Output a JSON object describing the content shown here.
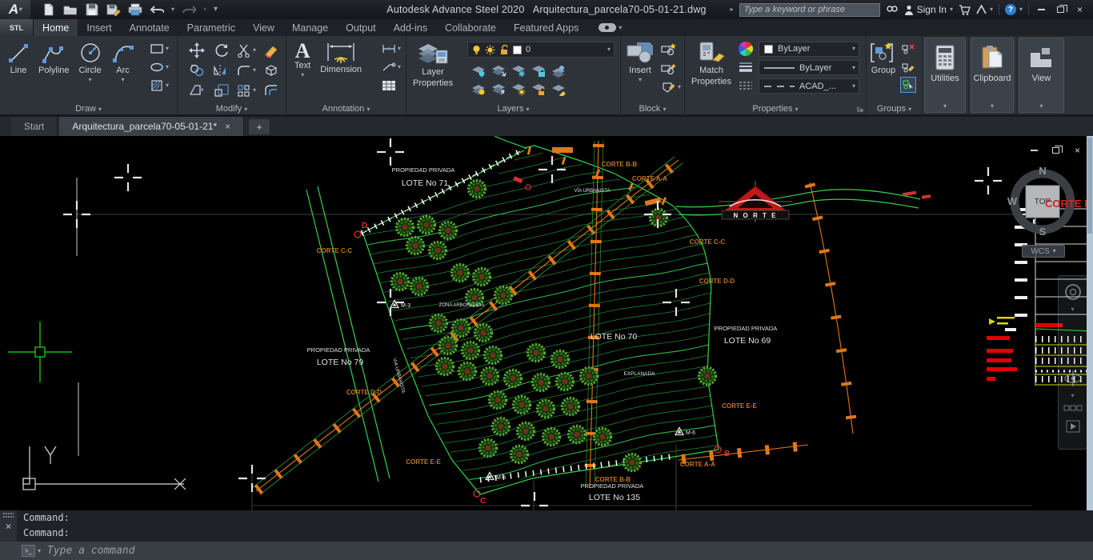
{
  "titlebar": {
    "app_title": "Autodesk Advance Steel 2020",
    "doc_title": "Arquitectura_parcela70-05-01-21.dwg",
    "search_placeholder": "Type a keyword or phrase",
    "sign_in_label": "Sign In"
  },
  "icons": {
    "dropdown": "▾",
    "close": "×",
    "plus": "+",
    "help": "?",
    "text_tool": "A",
    "command_prompt": ">_"
  },
  "ribbon": {
    "workspace_label": "STL",
    "tabs": [
      "Home",
      "Insert",
      "Annotate",
      "Parametric",
      "View",
      "Manage",
      "Output",
      "Add-ins",
      "Collaborate",
      "Featured Apps"
    ],
    "draw": {
      "panel_label": "Draw",
      "line": "Line",
      "polyline": "Polyline",
      "circle": "Circle",
      "arc": "Arc"
    },
    "modify": {
      "panel_label": "Modify"
    },
    "annotation": {
      "panel_label": "Annotation",
      "text": "Text",
      "dimension": "Dimension"
    },
    "layers": {
      "panel_label": "Layers",
      "layer_properties_line1": "Layer",
      "layer_properties_line2": "Properties",
      "current_layer": "0"
    },
    "block": {
      "panel_label": "Block",
      "insert": "Insert"
    },
    "properties": {
      "panel_label": "Properties",
      "match_line1": "Match",
      "match_line2": "Properties",
      "color": "ByLayer",
      "lineweight": "ByLayer",
      "linetype": "ACAD_..."
    },
    "groups": {
      "panel_label": "Groups",
      "group": "Group"
    },
    "utilities": {
      "panel_label": "Utilities"
    },
    "clipboard": {
      "panel_label": "Clipboard"
    },
    "view": {
      "panel_label": "View"
    }
  },
  "doc_tabs": {
    "start": "Start",
    "active": "Arquitectura_parcela70-05-01-21*"
  },
  "drawing": {
    "propiedad_privada": "PROPIEDAD PRIVADA",
    "lote_71": "LOTE No 71",
    "lote_79": "LOTE No 79",
    "lote_70": "LOTE No 70",
    "lote_69": "LOTE No 69",
    "lote_135": "LOTE No 135",
    "via_urbanista": "VÍA URBANISTA",
    "via_urbanista_rot": "VIA URBANISTA",
    "zona_arborizada": "ZONA ARBORIZADA",
    "explanada": "EXPLANADA",
    "corte_aa": "CORTE A-A",
    "corte_bb": "CORTE B-B",
    "corte_cc": "CORTE C-C",
    "corte_dd": "CORTE D-D",
    "corte_ee": "CORTE E-E",
    "norte": "N O R T E",
    "marker_m3": "M-3",
    "marker_m6": "M-6",
    "marker_m8": "M-8",
    "pt_b": "B",
    "pt_c": "C",
    "pt_d": "D",
    "viewcube_overlap_text": "CORTE E"
  },
  "viewcube": {
    "n": "N",
    "w": "W",
    "s": "S",
    "top": "TOP",
    "wcs": "WCS"
  },
  "command": {
    "history_line1": "Command:",
    "history_line2": "Command:",
    "input_placeholder": "Type a command"
  },
  "colors": {
    "contour_green": "#1f8a35",
    "boundary_green": "#35d04a",
    "road_orange": "#e07818",
    "label_orange": "#c07820",
    "label_white": "#dfe3e6",
    "annotation_red": "#d83030",
    "crosshair_green": "#18e018"
  }
}
